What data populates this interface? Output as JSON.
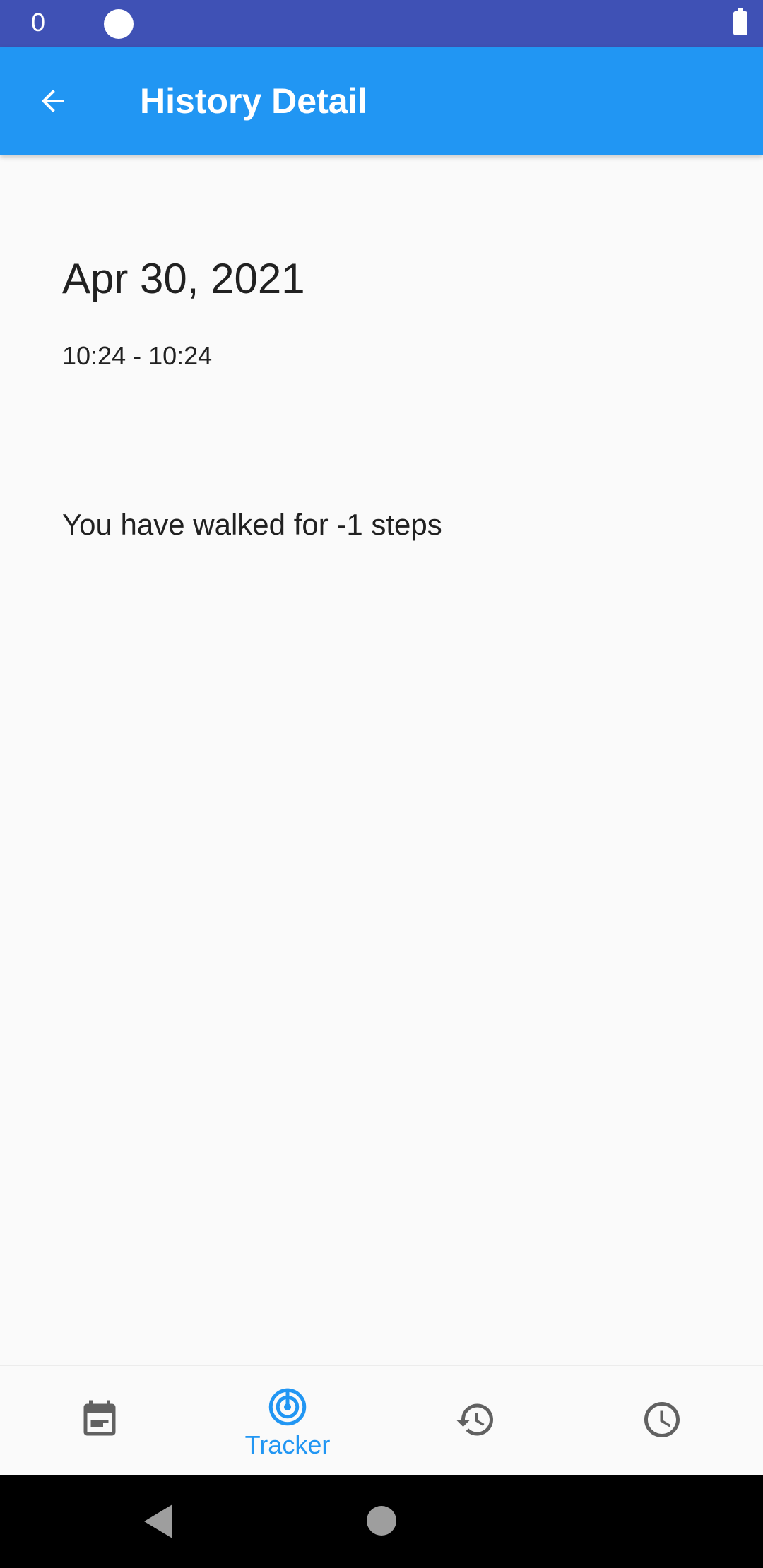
{
  "status_bar": {
    "left_text": "0"
  },
  "app_bar": {
    "title": "History Detail",
    "back_icon": "arrow-back-icon"
  },
  "detail": {
    "date": "Apr 30, 2021",
    "time_range": "10:24 - 10:24",
    "steps_text": "You have walked for -1 steps"
  },
  "bottom_nav": {
    "items": [
      {
        "icon": "calendar-note-icon",
        "label": "",
        "selected": false
      },
      {
        "icon": "tracker-radar-icon",
        "label": "Tracker",
        "selected": true
      },
      {
        "icon": "history-icon",
        "label": "",
        "selected": false
      },
      {
        "icon": "clock-icon",
        "label": "",
        "selected": false
      }
    ]
  },
  "colors": {
    "status_bar": "#3f51b5",
    "app_bar": "#2196f3",
    "accent": "#2196f3",
    "icon_inactive": "#616161",
    "background": "#fafafa"
  }
}
